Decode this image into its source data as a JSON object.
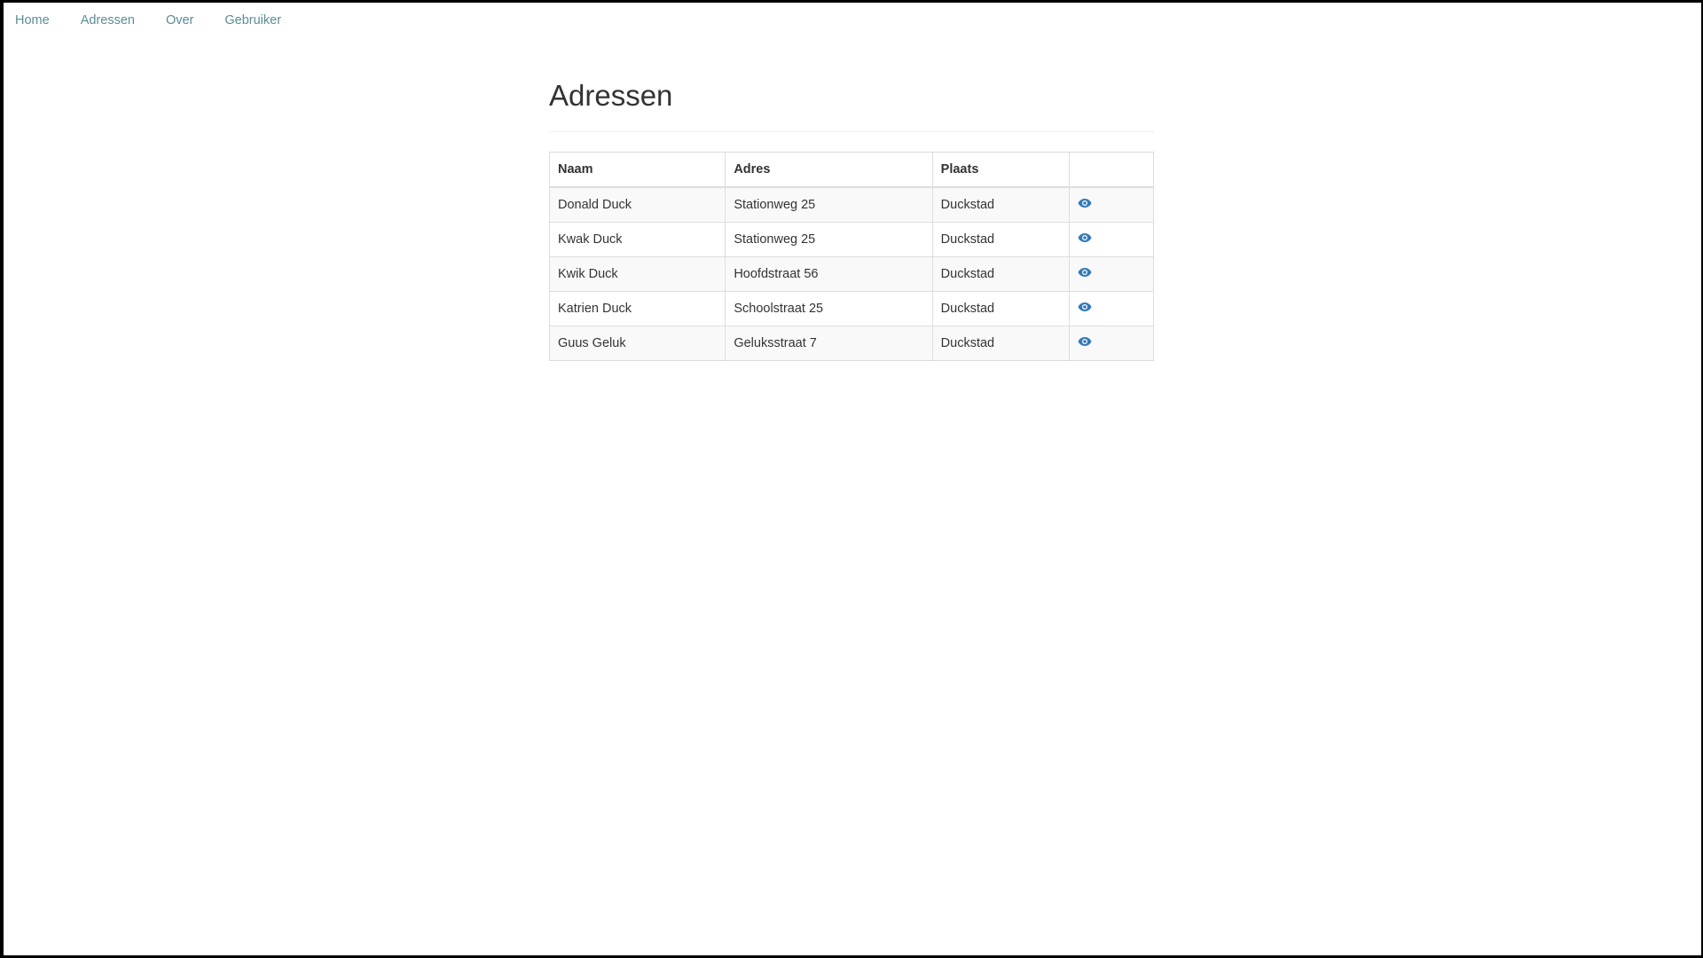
{
  "nav": {
    "items": [
      {
        "label": "Home"
      },
      {
        "label": "Adressen"
      },
      {
        "label": "Over"
      },
      {
        "label": "Gebruiker"
      }
    ]
  },
  "page": {
    "title": "Adressen"
  },
  "table": {
    "headers": {
      "naam": "Naam",
      "adres": "Adres",
      "plaats": "Plaats",
      "actie": ""
    },
    "rows": [
      {
        "naam": "Donald Duck",
        "adres": "Stationweg 25",
        "plaats": "Duckstad",
        "icon": "eye-icon"
      },
      {
        "naam": "Kwak Duck",
        "adres": "Stationweg 25",
        "plaats": "Duckstad",
        "icon": "eye-icon"
      },
      {
        "naam": "Kwik Duck",
        "adres": "Hoofdstraat 56",
        "plaats": "Duckstad",
        "icon": "eye-icon"
      },
      {
        "naam": "Katrien Duck",
        "adres": "Schoolstraat 25",
        "plaats": "Duckstad",
        "icon": "eye-icon"
      },
      {
        "naam": "Guus Geluk",
        "adres": "Geluksstraat 7",
        "plaats": "Duckstad",
        "icon": "eye-icon"
      }
    ]
  },
  "colors": {
    "nav_link": "#5b8c96",
    "icon": "#337ab7",
    "text": "#333333",
    "border": "#dddddd",
    "stripe": "#f9f9f9"
  }
}
